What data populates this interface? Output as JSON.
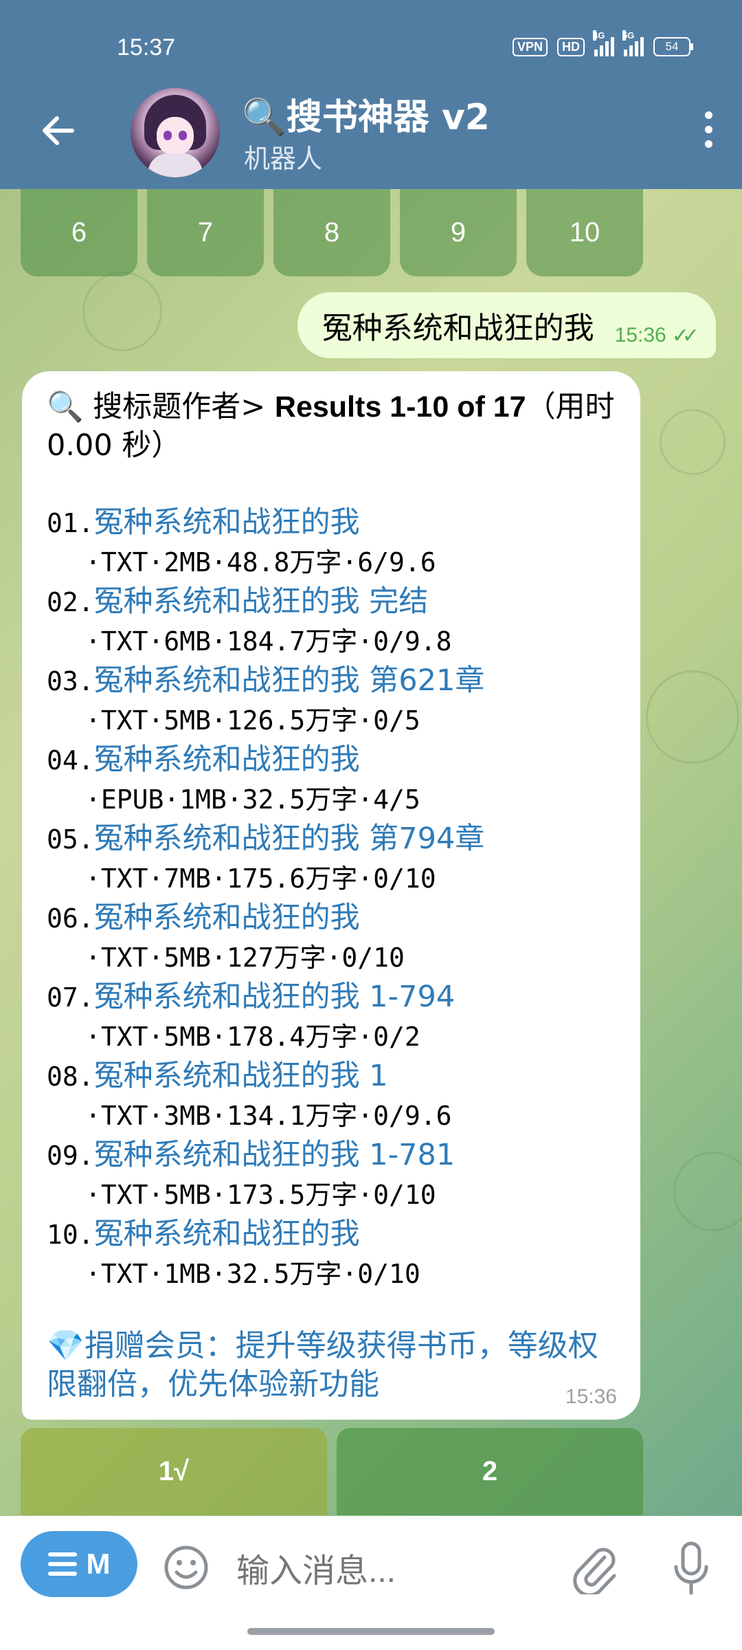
{
  "status": {
    "time": "15:37",
    "vpn": "VPN",
    "hd": "HD",
    "net1": "4G",
    "net2": "5G",
    "battery": "54"
  },
  "header": {
    "title": "🔍搜书神器 v2",
    "subtitle": "机器人"
  },
  "top_keyboard": [
    "6",
    "7",
    "8",
    "9",
    "10"
  ],
  "outgoing": {
    "text": "冤种系统和战狂的我",
    "time": "15:36"
  },
  "incoming": {
    "head_prefix": "🔍 搜标题作者> ",
    "head_results": "Results 1-10 of 17",
    "head_suffix": "（用时 0.00 秒）",
    "results": [
      {
        "num": "01.",
        "title": "冤种系统和战狂的我",
        "meta": "·TXT·2MB·48.8万字·6/9.6"
      },
      {
        "num": "02.",
        "title": "冤种系统和战狂的我 完结",
        "meta": "·TXT·6MB·184.7万字·0/9.8"
      },
      {
        "num": "03.",
        "title": "冤种系统和战狂的我 第621章",
        "meta": "·TXT·5MB·126.5万字·0/5"
      },
      {
        "num": "04.",
        "title": "冤种系统和战狂的我",
        "meta": "·EPUB·1MB·32.5万字·4/5"
      },
      {
        "num": "05.",
        "title": "冤种系统和战狂的我 第794章",
        "meta": "·TXT·7MB·175.6万字·0/10"
      },
      {
        "num": "06.",
        "title": "冤种系统和战狂的我",
        "meta": "·TXT·5MB·127万字·0/10"
      },
      {
        "num": "07.",
        "title": "冤种系统和战狂的我 1-794",
        "meta": "·TXT·5MB·178.4万字·0/2"
      },
      {
        "num": "08.",
        "title": "冤种系统和战狂的我 1",
        "meta": "·TXT·3MB·134.1万字·0/9.6"
      },
      {
        "num": "09.",
        "title": "冤种系统和战狂的我 1-781",
        "meta": "·TXT·5MB·173.5万字·0/10"
      },
      {
        "num": "10.",
        "title": "冤种系统和战狂的我",
        "meta": "·TXT·1MB·32.5万字·0/10"
      }
    ],
    "donate": "💎捐赠会员：提升等级获得书币，等级权限翻倍，优先体验新功能",
    "time": "15:36"
  },
  "bottom_keyboard": [
    "1√",
    "2"
  ],
  "composer": {
    "menu_label": "M",
    "placeholder": "输入消息..."
  }
}
